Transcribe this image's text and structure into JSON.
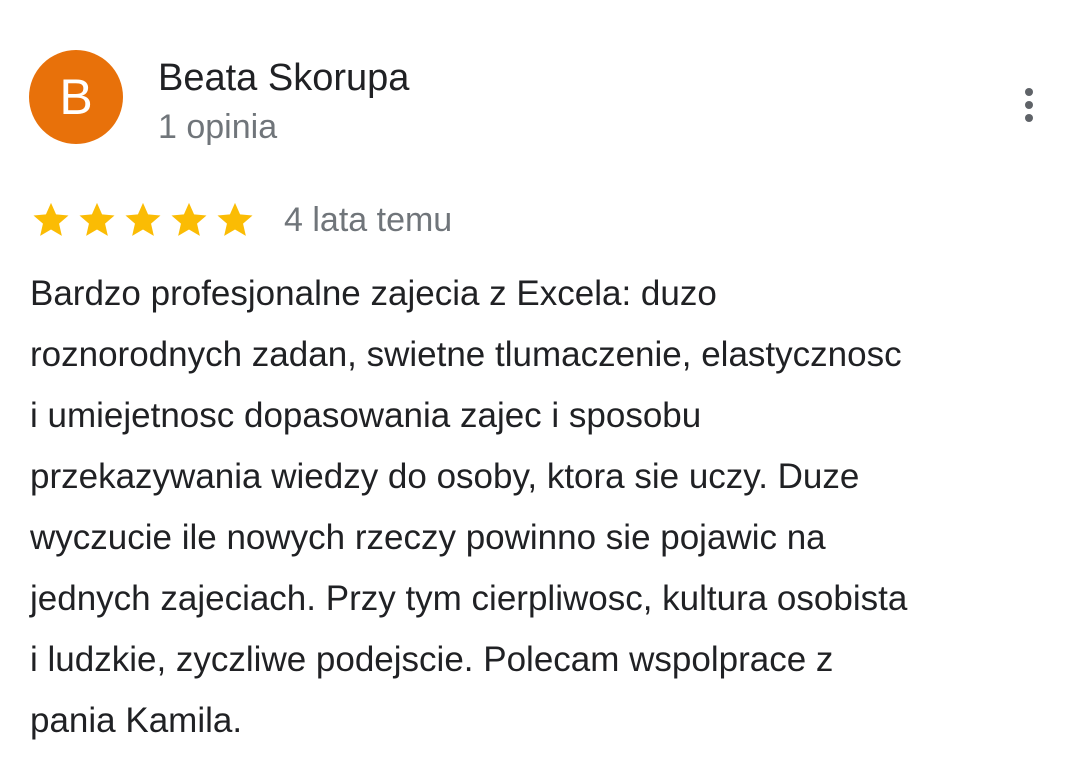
{
  "author": {
    "initial": "B",
    "name": "Beata Skorupa",
    "reviews_count": "1 opinia",
    "avatar_color": "#e8710a"
  },
  "menu": {
    "icon": "more-vert-icon"
  },
  "rating": {
    "stars": 5,
    "max_stars": 5,
    "star_color": "#fbbc04",
    "date": "4 lata temu"
  },
  "review": {
    "lines": [
      "Bardzo profesjonalne zajecia z Excela: duzo",
      "roznorodnych zadan, swietne tlumaczenie, elastycznosc",
      "i umiejetnosc dopasowania zajec i sposobu",
      "przekazywania wiedzy do osoby, ktora sie uczy. Duze",
      "wyczucie ile nowych rzeczy powinno sie pojawic na",
      "jednych zajeciach. Przy tym cierpliwosc, kultura osobista",
      "i ludzkie, zyczliwe podejscie. Polecam wspolprace z",
      "pania Kamila."
    ]
  }
}
